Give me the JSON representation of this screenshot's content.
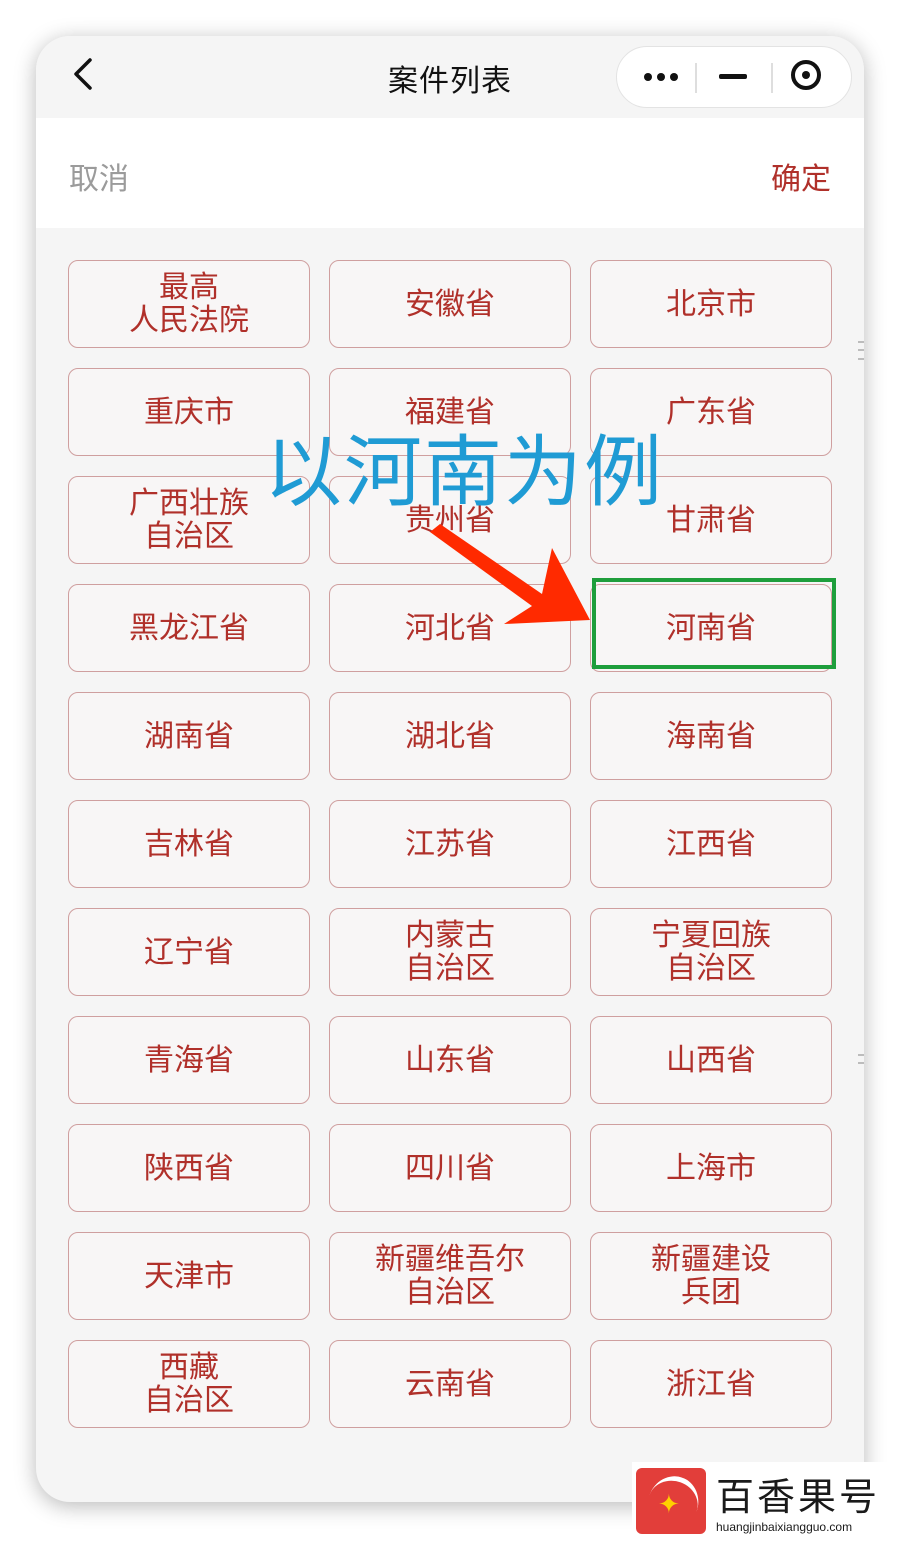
{
  "nav": {
    "title": "案件列表"
  },
  "actions": {
    "cancel": "取消",
    "confirm": "确定"
  },
  "provinces": [
    "最高\n人民法院",
    "安徽省",
    "北京市",
    "重庆市",
    "福建省",
    "广东省",
    "广西壮族\n自治区",
    "贵州省",
    "甘肃省",
    "黑龙江省",
    "河北省",
    "河南省",
    "湖南省",
    "湖北省",
    "海南省",
    "吉林省",
    "江苏省",
    "江西省",
    "辽宁省",
    "内蒙古\n自治区",
    "宁夏回族\n自治区",
    "青海省",
    "山东省",
    "山西省",
    "陕西省",
    "四川省",
    "上海市",
    "天津市",
    "新疆维吾尔\n自治区",
    "新疆建设\n兵团",
    "西藏\n自治区",
    "云南省",
    "浙江省"
  ],
  "highlighted_province": "河南省",
  "annotation": {
    "text": "以河南为例"
  },
  "watermark": {
    "name": "百香果号",
    "url": "huangjinbaixiangguo.com"
  },
  "colors": {
    "accent": "#b0302a",
    "highlight_border": "#1e9e3c",
    "annotation_text": "#1f9bd4",
    "arrow": "#ff2a00"
  }
}
